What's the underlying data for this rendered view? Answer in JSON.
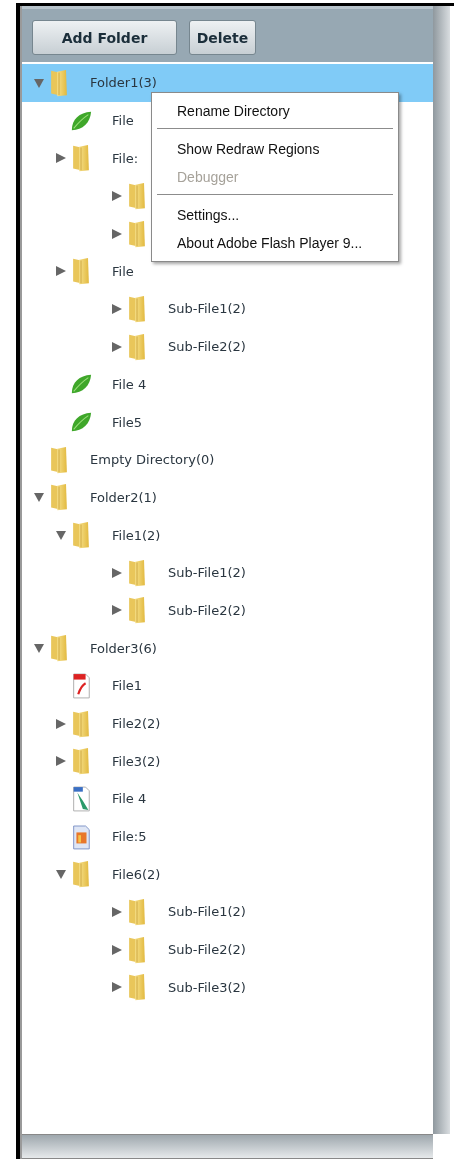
{
  "toolbar": {
    "buttons": [
      "Add Folder",
      "Delete"
    ]
  },
  "tree": [
    {
      "label": "Folder1(3)",
      "kind": "folder",
      "expanded": true,
      "selected": true,
      "children": [
        {
          "label": "File",
          "kind": "leaf",
          "selected": false
        },
        {
          "label": "File:",
          "kind": "folder",
          "expanded": false,
          "selected": false,
          "children": [
            {
              "kind": "folder",
              "expanded": false,
              "selected": false
            },
            {
              "kind": "folder",
              "expanded": false,
              "selected": false
            }
          ]
        },
        {
          "label": "File",
          "kind": "folder",
          "expanded": false,
          "selected": false,
          "children": [
            {
              "label": "Sub-File1(2)",
              "kind": "folder",
              "expanded": false,
              "selected": false
            },
            {
              "label": "Sub-File2(2)",
              "kind": "folder",
              "expanded": false,
              "selected": false
            }
          ]
        },
        {
          "label": "File 4",
          "kind": "leaf",
          "selected": false
        },
        {
          "label": "File5",
          "kind": "leaf",
          "selected": false
        }
      ]
    },
    {
      "label": "Empty Directory(0)",
      "kind": "folder",
      "selected": false
    },
    {
      "label": "Folder2(1)",
      "kind": "folder",
      "expanded": true,
      "selected": false,
      "children": [
        {
          "label": "File1(2)",
          "kind": "folder",
          "expanded": true,
          "selected": false,
          "children": [
            {
              "label": "Sub-File1(2)",
              "kind": "folder",
              "expanded": false,
              "selected": false
            },
            {
              "label": "Sub-File2(2)",
              "kind": "folder",
              "expanded": false,
              "selected": false
            }
          ]
        }
      ]
    },
    {
      "label": "Folder3(6)",
      "kind": "folder",
      "expanded": true,
      "selected": false,
      "children": [
        {
          "label": "File1",
          "kind": "flash",
          "selected": false
        },
        {
          "label": "File2(2)",
          "kind": "folder",
          "expanded": false,
          "selected": false
        },
        {
          "label": "File3(2)",
          "kind": "folder",
          "expanded": false,
          "selected": false
        },
        {
          "label": "File 4",
          "kind": "png",
          "selected": false
        },
        {
          "label": "File:5",
          "kind": "image",
          "selected": false
        },
        {
          "label": "File6(2)",
          "kind": "folder",
          "expanded": true,
          "selected": false,
          "children": [
            {
              "label": "Sub-File1(2)",
              "kind": "folder",
              "expanded": false,
              "selected": false
            },
            {
              "label": "Sub-File2(2)",
              "kind": "folder",
              "expanded": false,
              "selected": false
            },
            {
              "label": "Sub-File3(2)",
              "kind": "folder",
              "expanded": false,
              "selected": false
            }
          ]
        }
      ]
    }
  ],
  "context_menu": [
    {
      "kind": "item",
      "label": "Rename Directory",
      "disabled": false
    },
    {
      "kind": "separator"
    },
    {
      "kind": "item",
      "label": "Show Redraw Regions",
      "disabled": false
    },
    {
      "kind": "item",
      "label": "Debugger",
      "disabled": true
    },
    {
      "kind": "separator"
    },
    {
      "kind": "item",
      "label": "Settings...",
      "disabled": false
    },
    {
      "kind": "item",
      "label": "About Adobe Flash Player 9...",
      "disabled": false
    }
  ]
}
